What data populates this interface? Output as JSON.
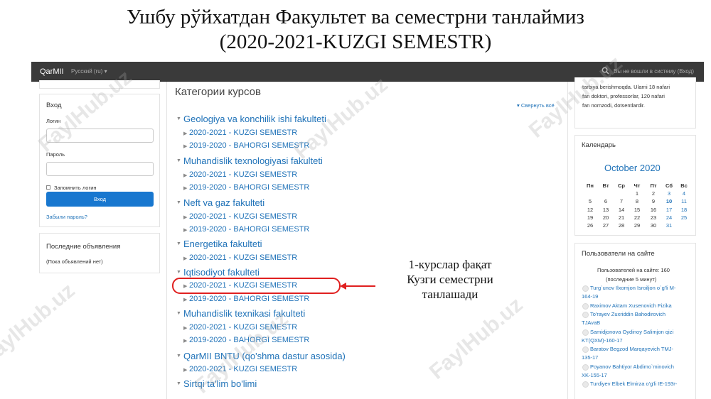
{
  "slide": {
    "title_line1": "Ушбу рўйхатдан Факультет ва семестрни танлаймиз",
    "title_line2": "(2020-2021-KUZGI SEMESTR)",
    "annotation_lines": [
      "1-курслар фақат",
      "Кузги семестрни",
      "танлашади"
    ],
    "watermark": "FaylHub.uz",
    "highlight_color": "#e02020"
  },
  "navbar": {
    "brand": "QarMII",
    "language": "Русский (ru)",
    "login_status": "Вы не вошли в систему (Вход)"
  },
  "login_block": {
    "title": "Вход",
    "login_label": "Логин",
    "login_value": "",
    "password_label": "Пароль",
    "password_value": "",
    "remember_label": "Запомнить логин",
    "submit_label": "Вход",
    "forgot_label": "Забыли пароль?"
  },
  "news_block": {
    "title": "Последние объявления",
    "empty_text": "(Пока объявлений нет)"
  },
  "categories": {
    "heading": "Категории курсов",
    "collapse_all": "Свернуть всё",
    "faculties": [
      {
        "name": "Geologiya va konchilik ishi fakulteti",
        "semesters": [
          "2020-2021 - KUZGI SEMESTR",
          "2019-2020 - BAHORGI SEMESTR"
        ]
      },
      {
        "name": "Muhandislik texnologiyasi fakulteti",
        "semesters": [
          "2020-2021 - KUZGI SEMESTR",
          "2019-2020 - BAHORGI SEMESTR"
        ]
      },
      {
        "name": "Neft va gaz fakulteti",
        "semesters": [
          "2020-2021 - KUZGI SEMESTR",
          "2019-2020 - BAHORGI SEMESTR"
        ]
      },
      {
        "name": "Energetika fakulteti",
        "semesters": [
          "2020-2021 - KUZGI SEMESTR"
        ]
      },
      {
        "name": "Iqtisodiyot fakulteti",
        "semesters": [
          "2020-2021 - KUZGI SEMESTR",
          "2019-2020 - BAHORGI SEMESTR"
        ]
      },
      {
        "name": "Muhandislik texnikasi fakulteti",
        "semesters": [
          "2020-2021 - KUZGI SEMESTR",
          "2019-2020 - BAHORGI SEMESTR"
        ]
      },
      {
        "name": "QarMII BNTU (qo'shma dastur asosida)",
        "semesters": [
          "2020-2021 - KUZGI SEMESTR"
        ]
      },
      {
        "name": "Sirtqi ta'lim bo'limi",
        "semesters": []
      }
    ]
  },
  "about_block": {
    "lines": [
      "tarbiya berishmoqda. Ularni 18 nafari",
      "fan doktori, professorlar, 120 nafari",
      "fan nomzodi, dotsentlardir."
    ]
  },
  "calendar": {
    "title": "Календарь",
    "month": "October 2020",
    "weekdays": [
      "Пн",
      "Вт",
      "Ср",
      "Чт",
      "Пт",
      "Сб",
      "Вс"
    ],
    "weeks": [
      [
        "",
        "",
        "",
        "1",
        "2",
        "3",
        "4"
      ],
      [
        "5",
        "6",
        "7",
        "8",
        "9",
        "10",
        "11"
      ],
      [
        "12",
        "13",
        "14",
        "15",
        "16",
        "17",
        "18"
      ],
      [
        "19",
        "20",
        "21",
        "22",
        "23",
        "24",
        "25"
      ],
      [
        "26",
        "27",
        "28",
        "29",
        "30",
        "31",
        ""
      ]
    ],
    "highlighted_day": "10"
  },
  "online_users": {
    "title": "Пользователи на сайте",
    "summary_line1": "Пользователей на сайте: 160",
    "summary_line2": "(последние 5 минут)",
    "lines": [
      "Turg`unov Ilxomjon Isroiljon o`g'li M-",
      "164-19",
      "Raximov Aktam Xusenovich Fizika",
      "To'rayev Zuxriddin Bahodirovich",
      "TJAvaB",
      "Samidjonova Oydinoy Salimjon qizi",
      "KT(QXM)-160-17",
      "Baratov Begzod Marqayevich TMJ-",
      "135-17",
      "Poyanov Bahtiyor Abdimo`minovich",
      "XK-155-17",
      "Turdiyev Elbek Elmirza o'g'li IE-193r-"
    ]
  }
}
